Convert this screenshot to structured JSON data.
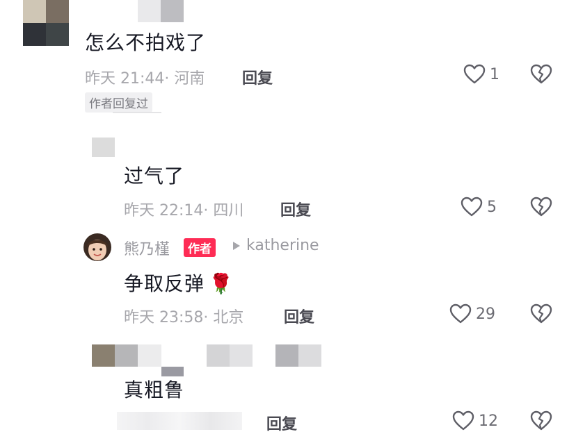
{
  "comments": [
    {
      "text": "怎么不拍戏了",
      "time": "昨天 21:44",
      "location": "河南",
      "reply_label": "回复",
      "likes": "1",
      "tag": "作者回复过"
    },
    {
      "text": "过气了",
      "time": "昨天 22:14",
      "location": "四川",
      "reply_label": "回复",
      "likes": "5"
    },
    {
      "author": "熊乃槿",
      "badge": "作者",
      "reply_to": "katherine",
      "text": "争取反弹",
      "emoji": "🌹",
      "time": "昨天 23:58",
      "location": "北京",
      "reply_label": "回复",
      "likes": "29"
    },
    {
      "text": "真粗鲁",
      "reply_label": "回复",
      "likes": "12"
    }
  ],
  "separator": "·",
  "colors": {
    "author_badge": "#fe2c55",
    "muted_text": "#a6a6ab"
  },
  "icons": {
    "like": "heart-outline-icon",
    "dislike": "broken-heart-icon",
    "reply_arrow": "play-triangle-icon"
  }
}
